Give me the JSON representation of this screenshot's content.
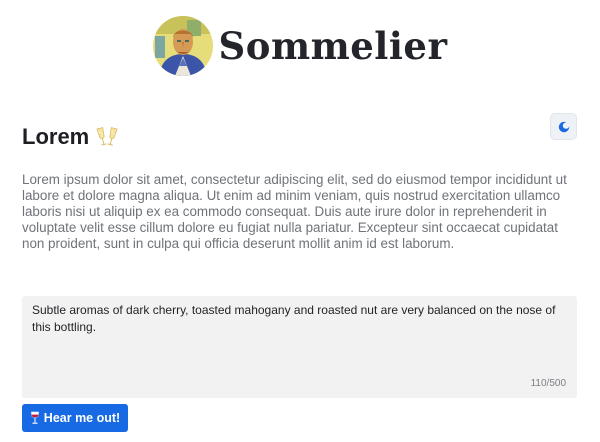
{
  "header": {
    "brand": "Sommelier",
    "avatar_icon": "portrait-avatar-icon"
  },
  "theme_toggle": {
    "icon": "half-moon-icon",
    "accent": "#1769e4"
  },
  "main": {
    "title": "Lorem",
    "title_icon": "clinking-glasses-icon",
    "intro": "Lorem ipsum dolor sit amet, consectetur adipiscing elit, sed do eiusmod tempor incididunt ut labore et dolore magna aliqua. Ut enim ad minim veniam, quis nostrud exercitation ullamco laboris nisi ut aliquip ex ea commodo consequat. Duis aute irure dolor in reprehenderit in voluptate velit esse cillum dolore eu fugiat nulla pariatur. Excepteur sint occaecat cupidatat non proident, sunt in culpa qui officia deserunt mollit anim id est laborum."
  },
  "tasting_note": {
    "value": "Subtle aromas of dark cherry, toasted mahogany and roasted nut are very balanced on the nose of this bottling.",
    "char_count": "110/500"
  },
  "submit": {
    "icon": "wine-glass-icon",
    "label": "Hear me out!",
    "color": "#1769e4"
  }
}
